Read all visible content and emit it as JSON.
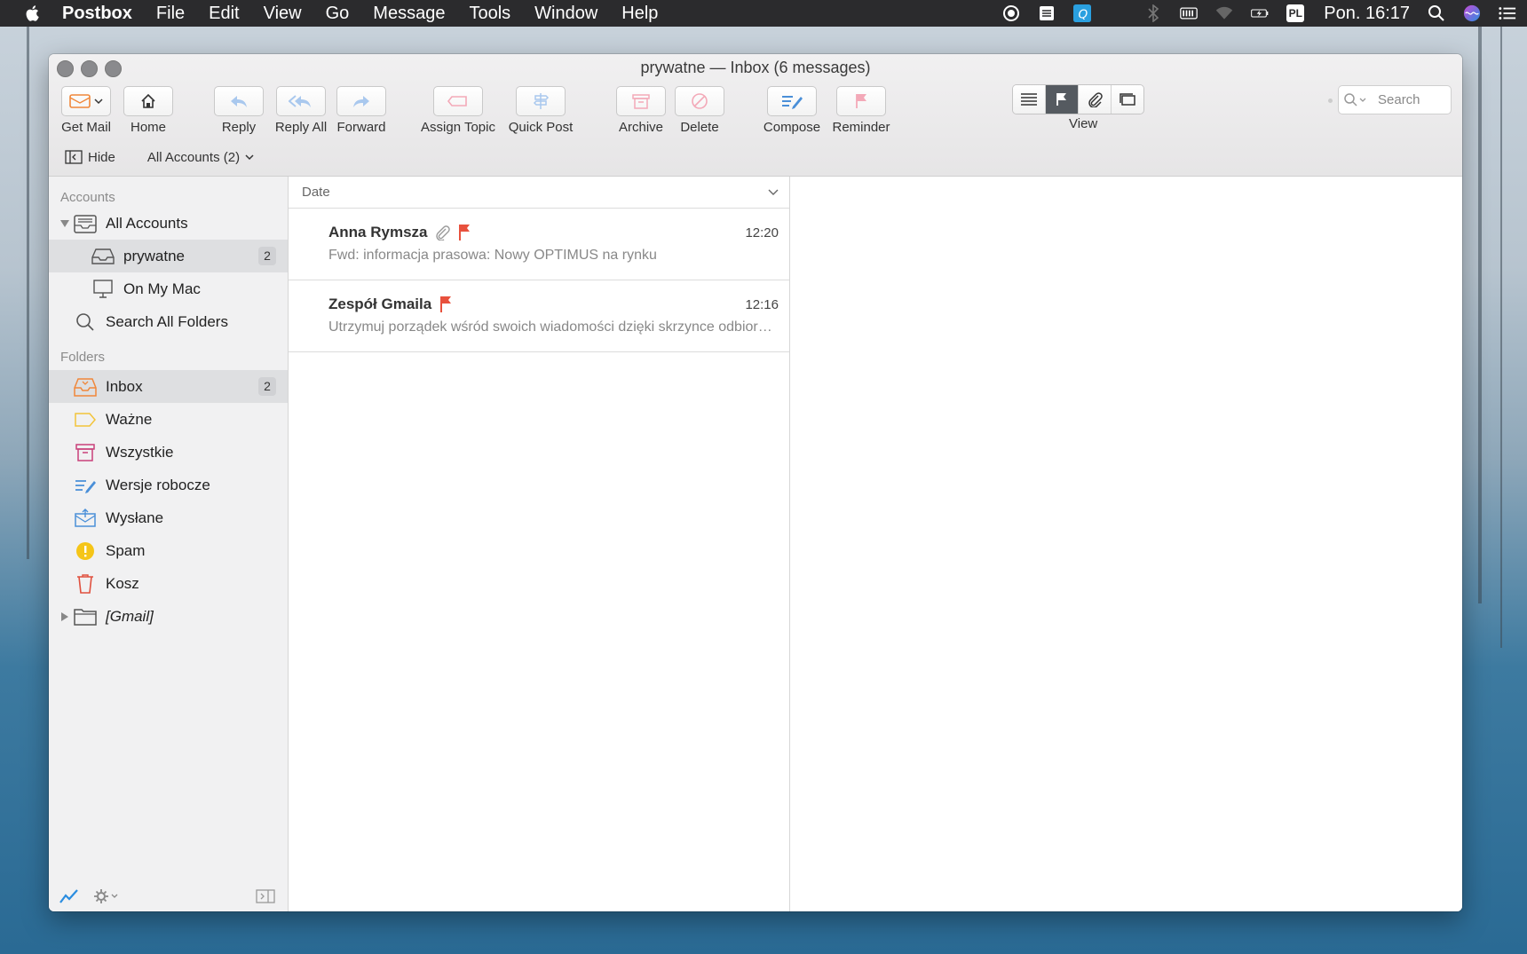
{
  "menubar": {
    "app_name": "Postbox",
    "items": [
      "File",
      "Edit",
      "View",
      "Go",
      "Message",
      "Tools",
      "Window",
      "Help"
    ],
    "input_source": "PL",
    "clock": "Pon. 16:17"
  },
  "window": {
    "title": "prywatne — Inbox (6 messages)"
  },
  "toolbar": {
    "get_mail": "Get Mail",
    "home": "Home",
    "reply": "Reply",
    "reply_all": "Reply All",
    "forward": "Forward",
    "assign_topic": "Assign Topic",
    "quick_post": "Quick Post",
    "archive": "Archive",
    "delete": "Delete",
    "compose": "Compose",
    "reminder": "Reminder",
    "view": "View",
    "search_placeholder": "Search"
  },
  "subbar": {
    "hide": "Hide",
    "accounts_selector": "All Accounts (2)"
  },
  "sidebar": {
    "accounts_header": "Accounts",
    "accounts": [
      {
        "label": "All Accounts",
        "icon": "all-accounts-icon"
      },
      {
        "label": "prywatne",
        "badge": "2",
        "icon": "inbox-tray-icon"
      },
      {
        "label": "On My Mac",
        "icon": "computer-icon"
      },
      {
        "label": "Search All Folders",
        "icon": "search-icon"
      }
    ],
    "folders_header": "Folders",
    "folders": [
      {
        "label": "Inbox",
        "badge": "2",
        "icon": "inbox-icon"
      },
      {
        "label": "Ważne",
        "icon": "label-icon"
      },
      {
        "label": "Wszystkie",
        "icon": "archive-icon"
      },
      {
        "label": "Wersje robocze",
        "icon": "drafts-icon"
      },
      {
        "label": "Wysłane",
        "icon": "sent-icon"
      },
      {
        "label": "Spam",
        "icon": "spam-icon"
      },
      {
        "label": "Kosz",
        "icon": "trash-icon"
      },
      {
        "label": "[Gmail]",
        "icon": "folder-icon"
      }
    ]
  },
  "message_list": {
    "sort_column": "Date",
    "messages": [
      {
        "sender": "Anna Rymsza",
        "time": "12:20",
        "subject": "Fwd: informacja prasowa: Nowy OPTIMUS na rynku",
        "attachment": true,
        "flagged": true
      },
      {
        "sender": "Zespół Gmaila",
        "time": "12:16",
        "subject": "Utrzymuj porządek wśród swoich wiadomości dzięki skrzynce odbiorczej Gmaila",
        "attachment": false,
        "flagged": true
      }
    ]
  },
  "colors": {
    "flag": "#e8513d",
    "accent_blue": "#4a8fd8",
    "inbox_orange": "#f0873a",
    "label_yellow": "#f3c43a",
    "archive_pink": "#c9417a",
    "spam_yellow": "#f5c518",
    "trash_red": "#e0503e"
  }
}
